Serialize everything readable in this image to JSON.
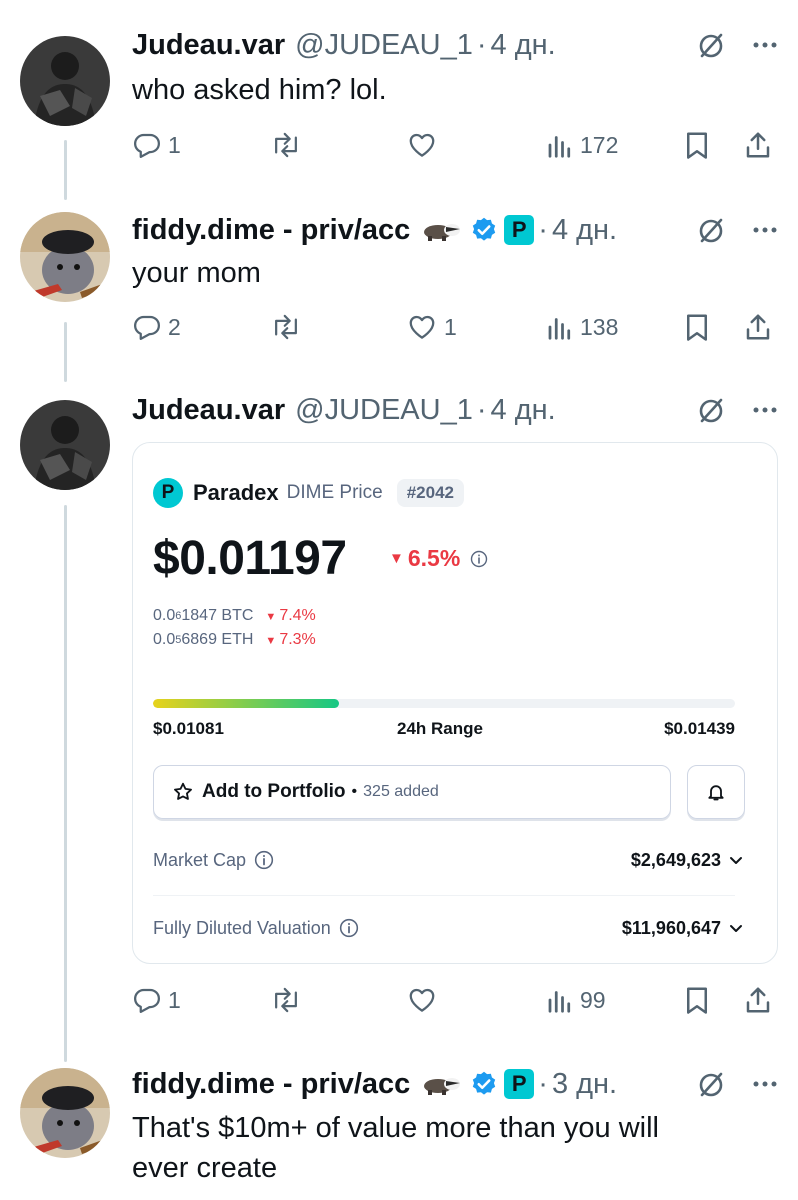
{
  "tweets": [
    {
      "name": "Judeau.var",
      "handle": "@JUDEAU_1",
      "time": "4 дн.",
      "text": "who asked him? lol.",
      "replies": "1",
      "reposts": "",
      "likes": "",
      "views": "172"
    },
    {
      "name": "fiddy.dime - priv/acc",
      "badge": "P",
      "time": "4 дн.",
      "text": "your mom",
      "replies": "2",
      "reposts": "",
      "likes": "1",
      "views": "138"
    },
    {
      "name": "Judeau.var",
      "handle": "@JUDEAU_1",
      "time": "4 дн.",
      "replies": "1",
      "reposts": "",
      "likes": "",
      "views": "99"
    },
    {
      "name": "fiddy.dime - priv/acc",
      "badge": "P",
      "time": "3 дн.",
      "text_line1": "That's $10m+ of value more than you will",
      "text_line2": "ever create"
    }
  ],
  "card": {
    "logo": "P",
    "token_name": "Paradex",
    "subtitle": "DIME Price",
    "rank": "#2042",
    "price": "$0.01197",
    "change": "6.5%",
    "btc_prefix": "0.0",
    "btc_sub": "6",
    "btc_rest": "1847 BTC",
    "btc_change": "7.4%",
    "eth_prefix": "0.0",
    "eth_sub": "5",
    "eth_rest": "6869 ETH",
    "eth_change": "7.3%",
    "range_low": "$0.01081",
    "range_label": "24h Range",
    "range_high": "$0.01439",
    "range_position": 0.32,
    "add_label": "Add to Portfolio",
    "dot": "•",
    "added_count": "325 added",
    "market_cap_label": "Market Cap",
    "market_cap_value": "$2,649,623",
    "fdv_label": "Fully Diluted Valuation",
    "fdv_value": "$11,960,647"
  },
  "icons": {
    "reply": "reply-icon",
    "repost": "repost-icon",
    "like": "heart-icon",
    "views": "views-icon",
    "bookmark": "bookmark-icon",
    "share": "share-icon",
    "grok": "grok-icon",
    "more": "more-icon",
    "verified": "verified-badge-icon",
    "badger": "badger-emoji-icon"
  },
  "colors": {
    "text": "#0f1419",
    "muted": "#536471",
    "verified": "#1d9bf0",
    "badge_cyan": "#00c8d2",
    "negative": "#ea3943",
    "range_start": "#e7d21c",
    "range_end": "#16c784"
  },
  "sep": "·"
}
